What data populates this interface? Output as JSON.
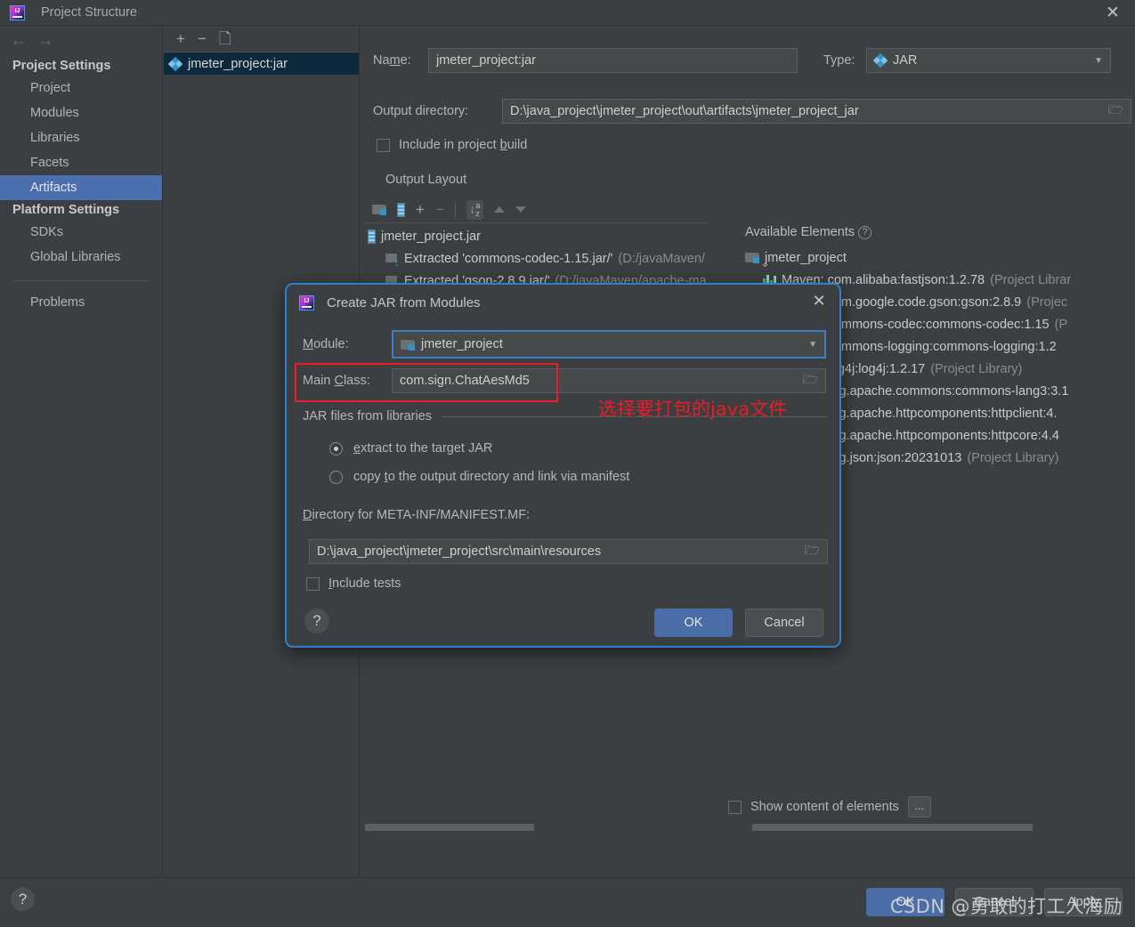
{
  "window": {
    "title": "Project Structure",
    "logo_icon": "intellij-idea-logo-icon",
    "close_icon": "close-icon"
  },
  "sidebar": {
    "back_icon": "arrow-left-icon",
    "forward_icon": "arrow-right-icon",
    "groups": [
      {
        "title": "Project Settings",
        "items": [
          {
            "label": "Project",
            "selected": false
          },
          {
            "label": "Modules",
            "selected": false
          },
          {
            "label": "Libraries",
            "selected": false
          },
          {
            "label": "Facets",
            "selected": false
          },
          {
            "label": "Artifacts",
            "selected": true
          }
        ]
      },
      {
        "title": "Platform Settings",
        "items": [
          {
            "label": "SDKs",
            "selected": false
          },
          {
            "label": "Global Libraries",
            "selected": false
          }
        ]
      }
    ],
    "problems_label": "Problems",
    "selected_color": "#4b6eaf"
  },
  "artifacts_panel": {
    "toolbar": {
      "add_label": "+",
      "remove_label": "−",
      "copy_icon": "copy-icon"
    },
    "items": [
      {
        "label": "jmeter_project:jar",
        "icon": "jar-artifact-icon",
        "selected": true
      }
    ],
    "selected_bg": "#0d293e"
  },
  "editor": {
    "name_label": "Name:",
    "name_value": "jmeter_project:jar",
    "type_label": "Type:",
    "type_value": "JAR",
    "type_icon": "jar-artifact-icon",
    "output_dir_label": "Output directory:",
    "output_dir_value": "D:\\java_project\\jmeter_project\\out\\artifacts\\jmeter_project_jar",
    "output_dir_browse_icon": "folder-icon",
    "include_in_build_label": "Include in project build",
    "include_in_build_checked": false,
    "output_layout_label": "Output Layout",
    "layout_toolbar": {
      "add_directory_icon": "new-folder-icon",
      "add_archive_icon": "archive-icon",
      "add_icon": "plus-dropdown-icon",
      "remove_icon": "minus-icon",
      "sort_icon": "sort-az-icon",
      "move_up_icon": "triangle-up-icon",
      "move_down_icon": "triangle-down-icon"
    },
    "tree": [
      {
        "label": "jmeter_project.jar",
        "note": "",
        "icon": "archive-icon",
        "indent": 0,
        "expanded": true
      },
      {
        "label": "Extracted 'commons-codec-1.15.jar/'",
        "note": "(D:/javaMaven/",
        "icon": "extracted-icon",
        "indent": 1
      },
      {
        "label": "Extracted 'gson-2.8.9.jar/'",
        "note": "(D:/javaMaven/apache-ma",
        "icon": "extracted-icon",
        "indent": 1
      }
    ],
    "available_elements_label": "Available Elements",
    "available_elements_help_icon": "help-circle-icon",
    "available": [
      {
        "label": "jmeter_project",
        "note": "",
        "icon": "module-folder-icon",
        "indent": 0
      },
      {
        "label": "Maven: com.alibaba:fastjson:1.2.78",
        "note": "(Project Librar",
        "icon": "library-bars-icon",
        "indent": 1
      },
      {
        "label": "Maven: com.google.code.gson:gson:2.8.9",
        "note": "(Projec",
        "icon": "library-bars-icon",
        "indent": 1
      },
      {
        "label": "Maven: commons-codec:commons-codec:1.15",
        "note": "(P",
        "icon": "library-bars-icon",
        "indent": 1
      },
      {
        "label": "Maven: commons-logging:commons-logging:1.2",
        "note": "",
        "icon": "library-bars-icon",
        "indent": 1
      },
      {
        "label": "Maven: log4j:log4j:1.2.17",
        "note": "(Project Library)",
        "icon": "library-bars-icon",
        "indent": 1
      },
      {
        "label": "Maven: org.apache.commons:commons-lang3:3.1",
        "note": "",
        "icon": "library-bars-icon",
        "indent": 1
      },
      {
        "label": "Maven: org.apache.httpcomponents:httpclient:4.",
        "note": "",
        "icon": "library-bars-icon",
        "indent": 1
      },
      {
        "label": "Maven: org.apache.httpcomponents:httpcore:4.4",
        "note": "",
        "icon": "library-bars-icon",
        "indent": 1
      },
      {
        "label": "Maven: org.json:json:20231013",
        "note": "(Project Library)",
        "icon": "library-bars-icon",
        "indent": 1
      }
    ],
    "show_content_label": "Show content of elements",
    "show_content_checked": false,
    "more_button_label": "..."
  },
  "footer": {
    "help_icon": "help-circle-icon",
    "ok_label": "OK",
    "cancel_label": "Cancel",
    "apply_label": "Apply"
  },
  "watermark": {
    "text": "CSDN @勇敢的打工人海励"
  },
  "dialog": {
    "title": "Create JAR from Modules",
    "logo_icon": "intellij-idea-logo-icon",
    "close_icon": "close-icon",
    "module_label": "Module:",
    "module_value": "jmeter_project",
    "module_icon": "module-folder-icon",
    "main_class_label": "Main Class:",
    "main_class_value": "com.sign.ChatAesMd5",
    "main_class_browse_icon": "folder-icon",
    "jar_files_group_label": "JAR files from libraries",
    "radio_extract_label": "extract to the target JAR",
    "radio_copy_label": "copy to the output directory and link via manifest",
    "radio_selected": "extract",
    "manifest_dir_label": "Directory for META-INF/MANIFEST.MF:",
    "manifest_dir_value": "D:\\java_project\\jmeter_project\\src\\main\\resources",
    "manifest_browse_icon": "folder-icon",
    "include_tests_label": "Include tests",
    "include_tests_checked": false,
    "help_icon": "help-circle-icon",
    "ok_label": "OK",
    "cancel_label": "Cancel",
    "border_color": "#2f7fce"
  },
  "annotation": {
    "text": "选择要打包的java文件",
    "color": "#ec1c24"
  }
}
